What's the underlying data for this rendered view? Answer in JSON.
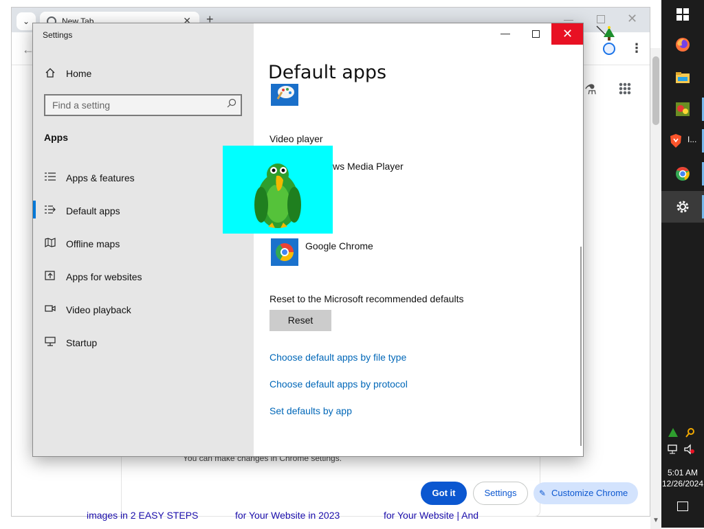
{
  "chrome": {
    "tab_title": "New Tab",
    "pane_note": "You can make changes in Chrome settings.",
    "got_it_label": "Got it",
    "settings_label": "Settings",
    "customize_label": "Customize Chrome",
    "links": [
      "images in 2 EASY STEPS",
      "for Your Website in 2023",
      "for Your Website | And"
    ]
  },
  "settings_window": {
    "title": "Settings",
    "home_label": "Home",
    "search_placeholder": "Find a setting",
    "section_heading": "Apps",
    "nav_items": [
      {
        "label": "Apps & features",
        "icon": "list-icon"
      },
      {
        "label": "Default apps",
        "icon": "default-apps-icon",
        "active": true
      },
      {
        "label": "Offline maps",
        "icon": "map-icon"
      },
      {
        "label": "Apps for websites",
        "icon": "open-in-icon"
      },
      {
        "label": "Video playback",
        "icon": "video-icon"
      },
      {
        "label": "Startup",
        "icon": "startup-icon"
      }
    ],
    "page_title": "Default apps",
    "video_player_label": "Video player",
    "video_player_app": "ws Media Player",
    "web_browser_app": "Google Chrome",
    "reset_heading": "Reset to the Microsoft recommended defaults",
    "reset_label": "Reset",
    "links": [
      "Choose default apps by file type",
      "Choose default apps by protocol",
      "Set defaults by app"
    ]
  },
  "taskbar": {
    "time": "5:01 AM",
    "date": "12/26/2024",
    "brave_label": "I..."
  },
  "colors": {
    "accent": "#0078d7",
    "close_red": "#e81123",
    "chrome_blue": "#0b57d0",
    "parrot_bg": "#00ffff"
  }
}
